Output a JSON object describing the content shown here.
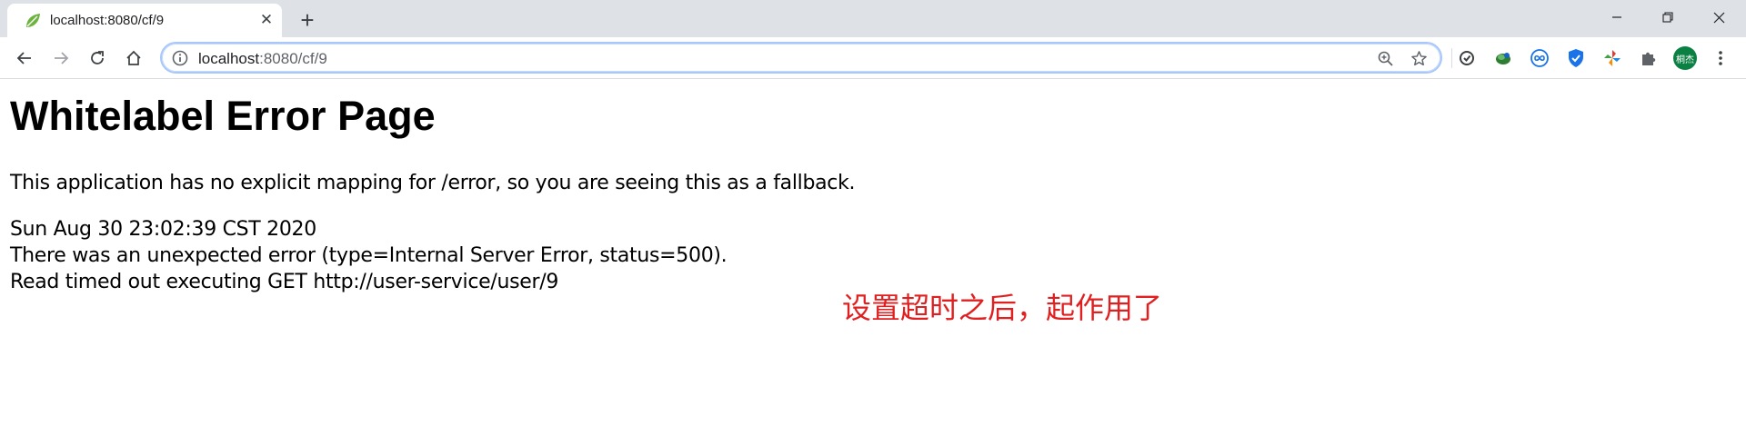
{
  "browser": {
    "tab": {
      "title": "localhost:8080/cf/9",
      "favicon": "spring-leaf-icon",
      "close": "✕"
    },
    "new_tab": "+",
    "window_controls": [
      "minimize-icon",
      "restore-icon",
      "close-icon"
    ],
    "toolbar": {
      "nav": [
        "back-icon",
        "forward-icon",
        "reload-icon",
        "home-icon"
      ],
      "omnibox": {
        "host": "localhost",
        "path": ":8080/cf/9",
        "icons": [
          "info-icon",
          "zoom-icon",
          "bookmark-star-icon"
        ]
      },
      "extensions": [
        "sync-extension-icon",
        "globe-extension-icon",
        "infinity-extension-icon",
        "shield-extension-icon",
        "pinwheel-extension-icon",
        "puzzle-extension-icon"
      ],
      "avatar_label": "桐杰",
      "menu": "menu-dots-icon"
    },
    "colors": {
      "tabstrip": "#dee1e6",
      "omnibox_border": "#a8c7fa",
      "avatar": "#0b8043",
      "annotation": "#e02020"
    }
  },
  "page": {
    "title": "Whitelabel Error Page",
    "intro": "This application has no explicit mapping for /error, so you are seeing this as a fallback.",
    "timestamp": "Sun Aug 30 23:02:39 CST 2020",
    "error_line": "There was an unexpected error (type=Internal Server Error, status=500).",
    "message": "Read timed out executing GET http://user-service/user/9"
  },
  "annotation": "设置超时之后，起作用了"
}
